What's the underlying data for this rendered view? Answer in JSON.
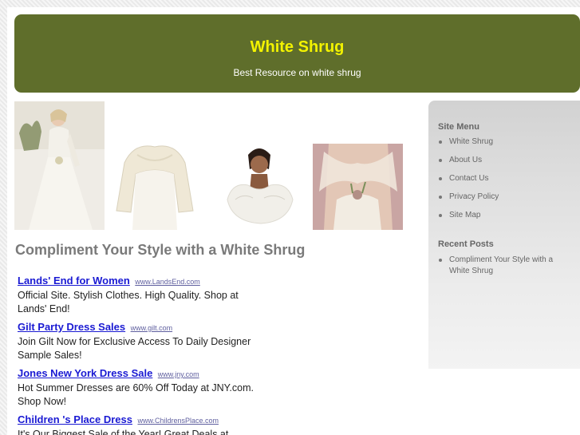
{
  "header": {
    "title": "White Shrug",
    "tagline": "Best Resource on white shrug"
  },
  "main": {
    "heading": "Compliment Your Style with a White Shrug",
    "ads": [
      {
        "title": "Lands' End for Women",
        "domain": "www.LandsEnd.com",
        "desc": "Official Site. Stylish Clothes. High Quality. Shop at Lands' End!"
      },
      {
        "title": "Gilt Party Dress Sales",
        "domain": "www.gilt.com",
        "desc": "Join Gilt Now for Exclusive Access To Daily Designer Sample Sales!"
      },
      {
        "title": "Jones New York Dress Sale",
        "domain": "www.jny.com",
        "desc": "Hot Summer Dresses are 60% Off Today at JNY.com. Shop Now!"
      },
      {
        "title": "Children 's Place Dress",
        "domain": "www.ChildrensPlace.com",
        "desc": "It's Our Biggest Sale of the Year! Great Deals at"
      }
    ]
  },
  "sidebar": {
    "menu_title": "Site Menu",
    "menu_items": [
      "White Shrug",
      "About Us",
      "Contact Us",
      "Privacy Policy",
      "Site Map"
    ],
    "recent_title": "Recent Posts",
    "recent_items": [
      "Compliment Your Style with a White Shrug"
    ]
  },
  "colors": {
    "header_bg": "#5f6e2b",
    "title_color": "#f3f300",
    "link_color": "#1a1ad3"
  }
}
